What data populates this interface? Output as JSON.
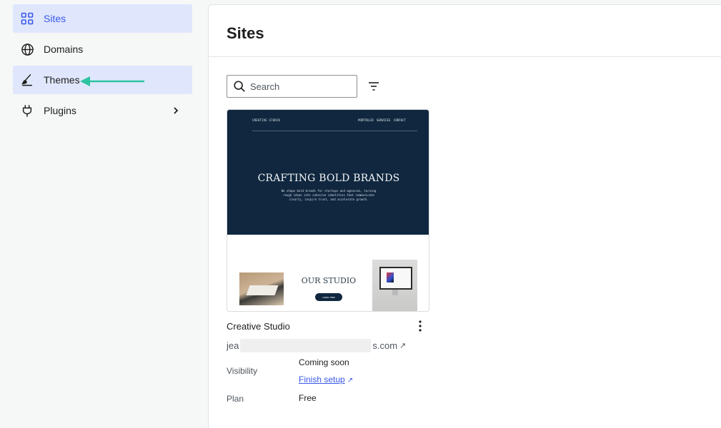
{
  "sidebar": {
    "items": [
      {
        "label": "Sites",
        "icon": "grid-icon"
      },
      {
        "label": "Domains",
        "icon": "globe-icon"
      },
      {
        "label": "Themes",
        "icon": "brush-icon"
      },
      {
        "label": "Plugins",
        "icon": "plug-icon"
      }
    ]
  },
  "main": {
    "title": "Sites",
    "search": {
      "placeholder": "Search"
    },
    "site": {
      "thumbnail": {
        "brand": "CREATIVE STUDIO",
        "nav": [
          "PORTFOLIO",
          "SERVICES",
          "CONTACT"
        ],
        "hero_title": "CRAFTING BOLD BRANDS",
        "hero_sub": "We shape bold brands for startups and agencies, turning rough ideas into cohesive identities that communicate clearly, inspire trust, and accelerate growth.",
        "section_title": "OUR STUDIO",
        "button": "LEARN MORE"
      },
      "name": "Creative Studio",
      "url_prefix": "jea",
      "url_suffix": "s.com",
      "visibility_label": "Visibility",
      "visibility_value": "Coming soon",
      "finish_setup": "Finish setup",
      "plan_label": "Plan",
      "plan_value": "Free"
    }
  },
  "colors": {
    "accent": "#3858e9",
    "active_bg": "#e0e7fc",
    "annotation_arrow": "#2cc4a0",
    "hero_bg": "#10273f"
  }
}
